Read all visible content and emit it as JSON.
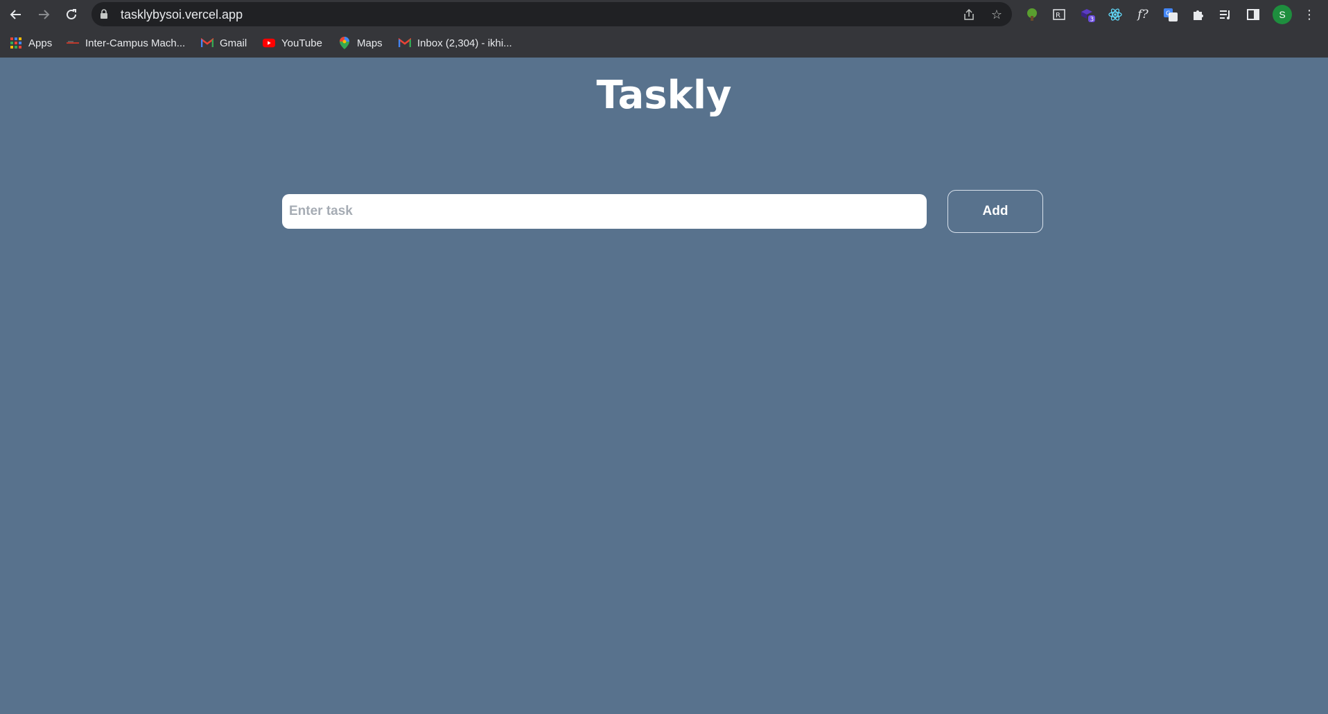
{
  "browser": {
    "url": "tasklybysoi.vercel.app",
    "profile_initial": "S",
    "extension_badge": "3",
    "nav_icons": [
      "back-arrow-icon",
      "forward-arrow-icon",
      "reload-icon"
    ],
    "omnibox_icons": [
      "lock-icon",
      "share-icon",
      "star-icon"
    ],
    "extensions": [
      "tree-extension-icon",
      "grammarly-icon",
      "purple-extension-icon",
      "react-devtools-icon",
      "fx-extension-icon",
      "translate-icon",
      "puzzle-extensions-icon",
      "reading-list-icon",
      "side-panel-icon"
    ],
    "bookmarks": [
      {
        "label": "Apps",
        "icon": "apps-grid-icon"
      },
      {
        "label": "Inter-Campus Mach...",
        "icon": "campus-icon"
      },
      {
        "label": "Gmail",
        "icon": "gmail-icon"
      },
      {
        "label": "YouTube",
        "icon": "youtube-icon"
      },
      {
        "label": "Maps",
        "icon": "maps-pin-icon"
      },
      {
        "label": "Inbox (2,304) - ikhi...",
        "icon": "gmail-icon"
      }
    ]
  },
  "app": {
    "title": "Taskly",
    "input_placeholder": "Enter task",
    "input_value": "",
    "add_button_label": "Add"
  },
  "colors": {
    "page_background": "#58728d",
    "chrome_background": "#35363a",
    "omnibox_background": "#202124",
    "profile_avatar": "#1e8e3e"
  }
}
